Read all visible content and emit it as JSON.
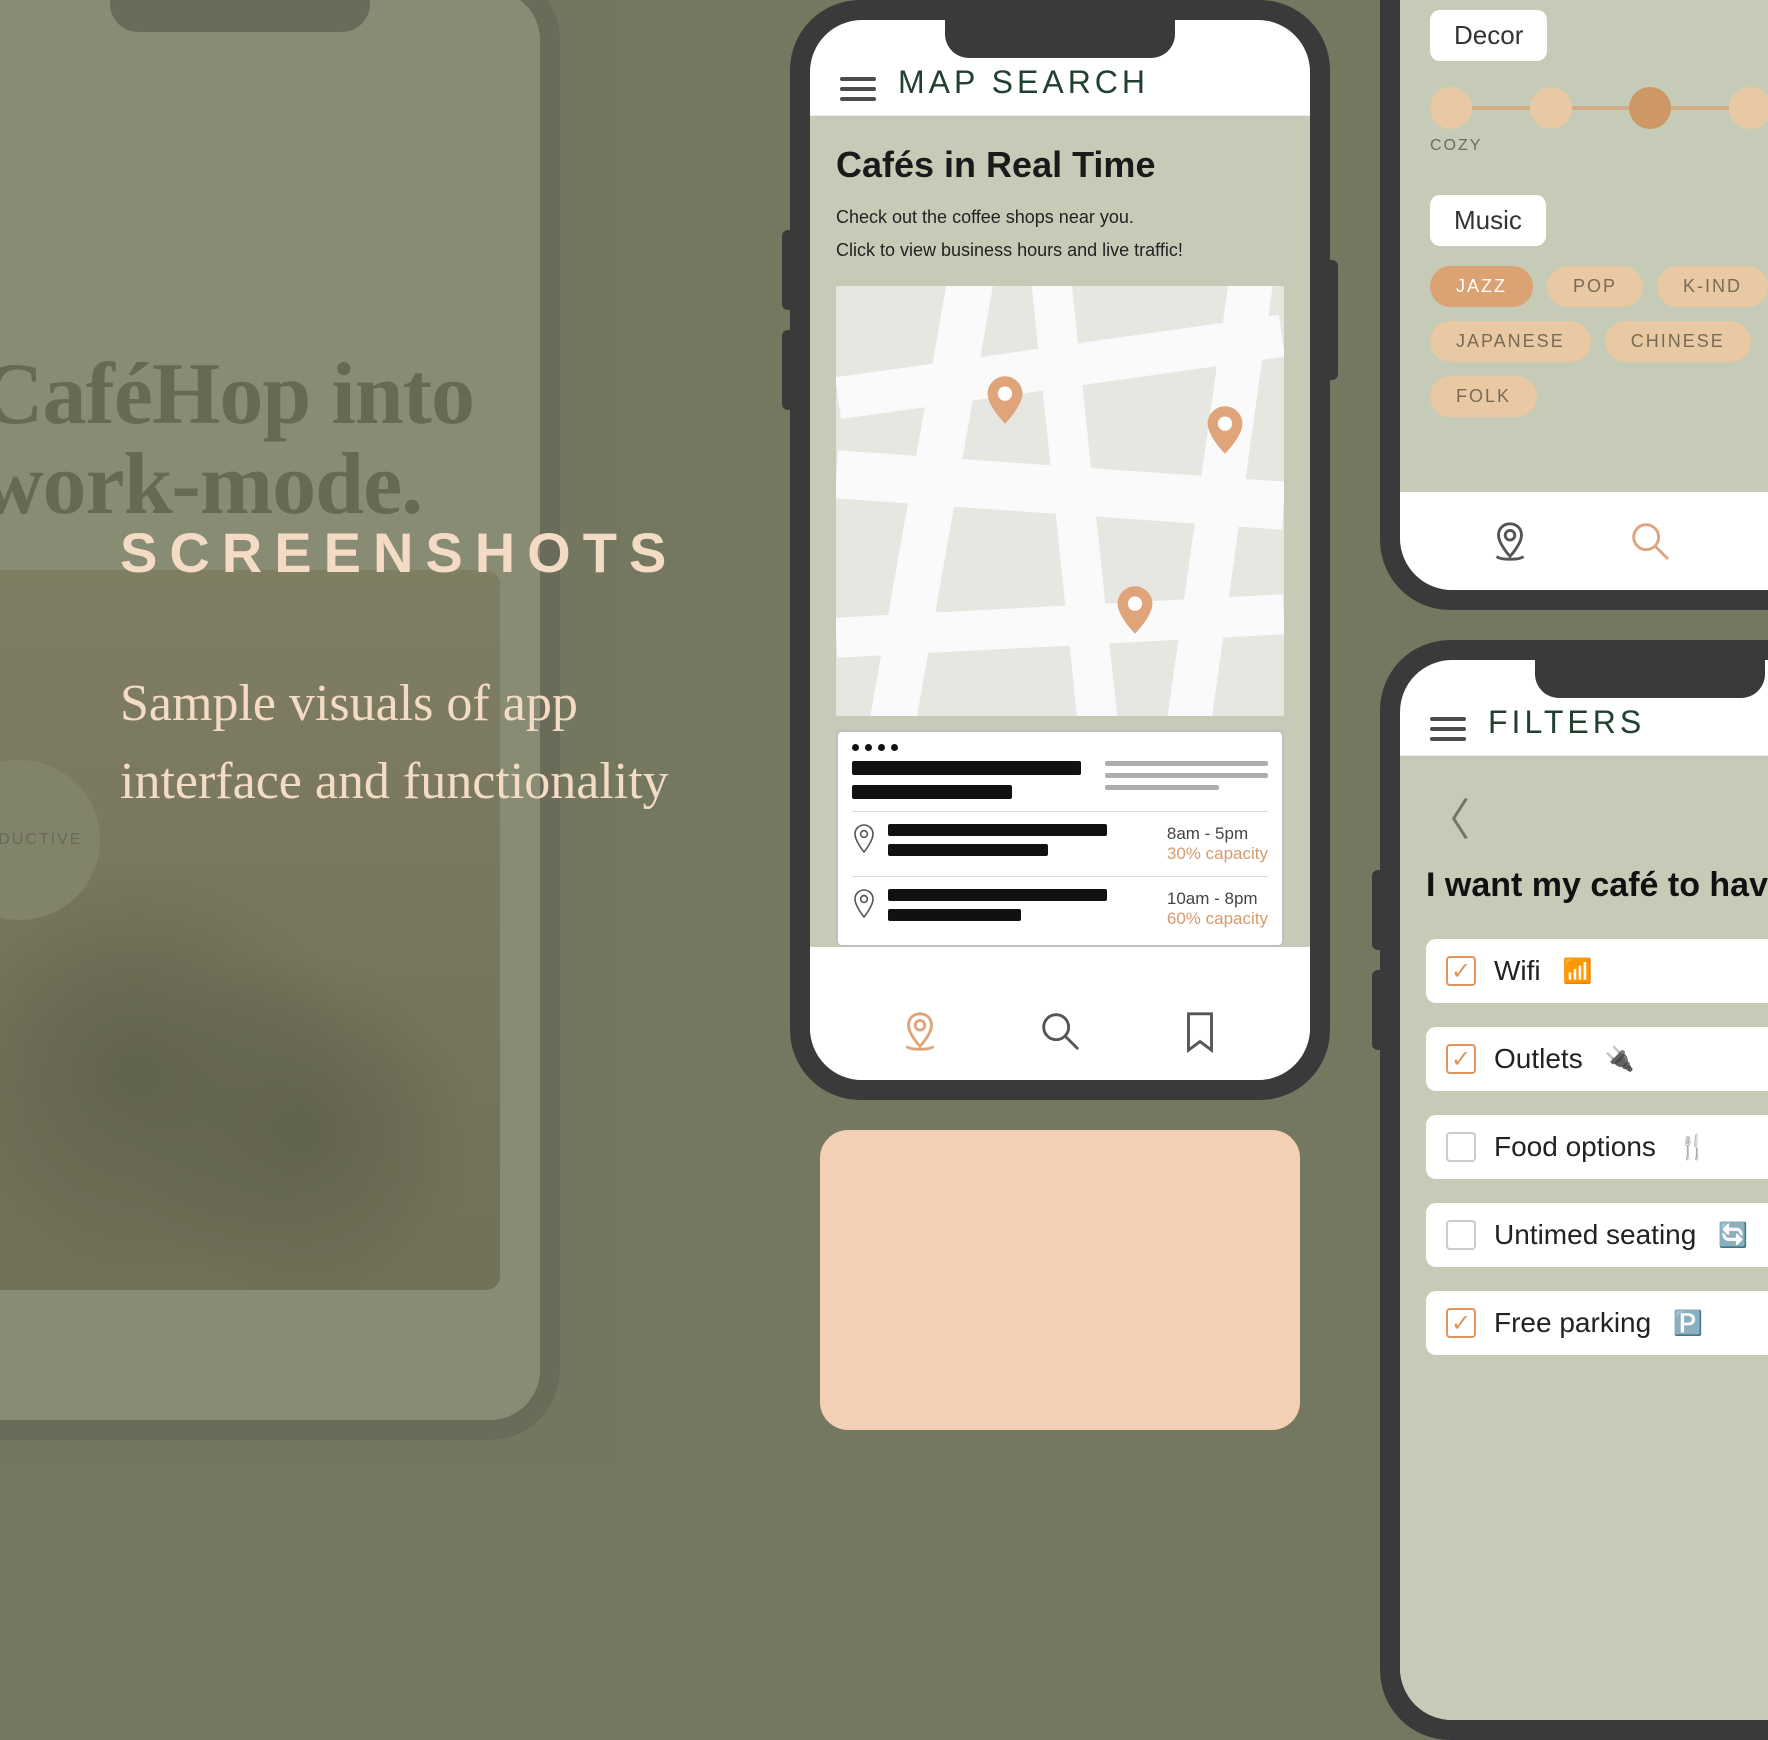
{
  "text": {
    "eyebrow": "SCREENSHOTS",
    "desc": "Sample visuals of app interface and functionality"
  },
  "ghost": {
    "headline": "CaféHop into work-mode.",
    "badge": "PRODUCTIVE"
  },
  "map_screen": {
    "title": "MAP SEARCH",
    "heading": "Cafés in Real Time",
    "sub1": "Check out the coffee shops near you.",
    "sub2": "Click to view business hours and live traffic!",
    "entries": [
      {
        "hours": "8am - 5pm",
        "capacity": "30% capacity"
      },
      {
        "hours": "10am - 8pm",
        "capacity": "60% capacity"
      }
    ]
  },
  "decor_screen": {
    "label_decor": "Decor",
    "caption_left": "COZY",
    "label_music": "Music",
    "tags": [
      "JAZZ",
      "POP",
      "K-IND",
      "JAPANESE",
      "CHINESE",
      "FOLK"
    ]
  },
  "filters_screen": {
    "title": "FILTERS",
    "heading": "I want my café to have…",
    "items": [
      {
        "label": "Wifi",
        "checked": true,
        "emoji": "📶"
      },
      {
        "label": "Outlets",
        "checked": true,
        "emoji": "🔌"
      },
      {
        "label": "Food options",
        "checked": false,
        "emoji": "🍴"
      },
      {
        "label": "Untimed seating",
        "checked": false,
        "emoji": "🔄"
      },
      {
        "label": "Free parking",
        "checked": true,
        "emoji": "🅿️"
      }
    ]
  }
}
